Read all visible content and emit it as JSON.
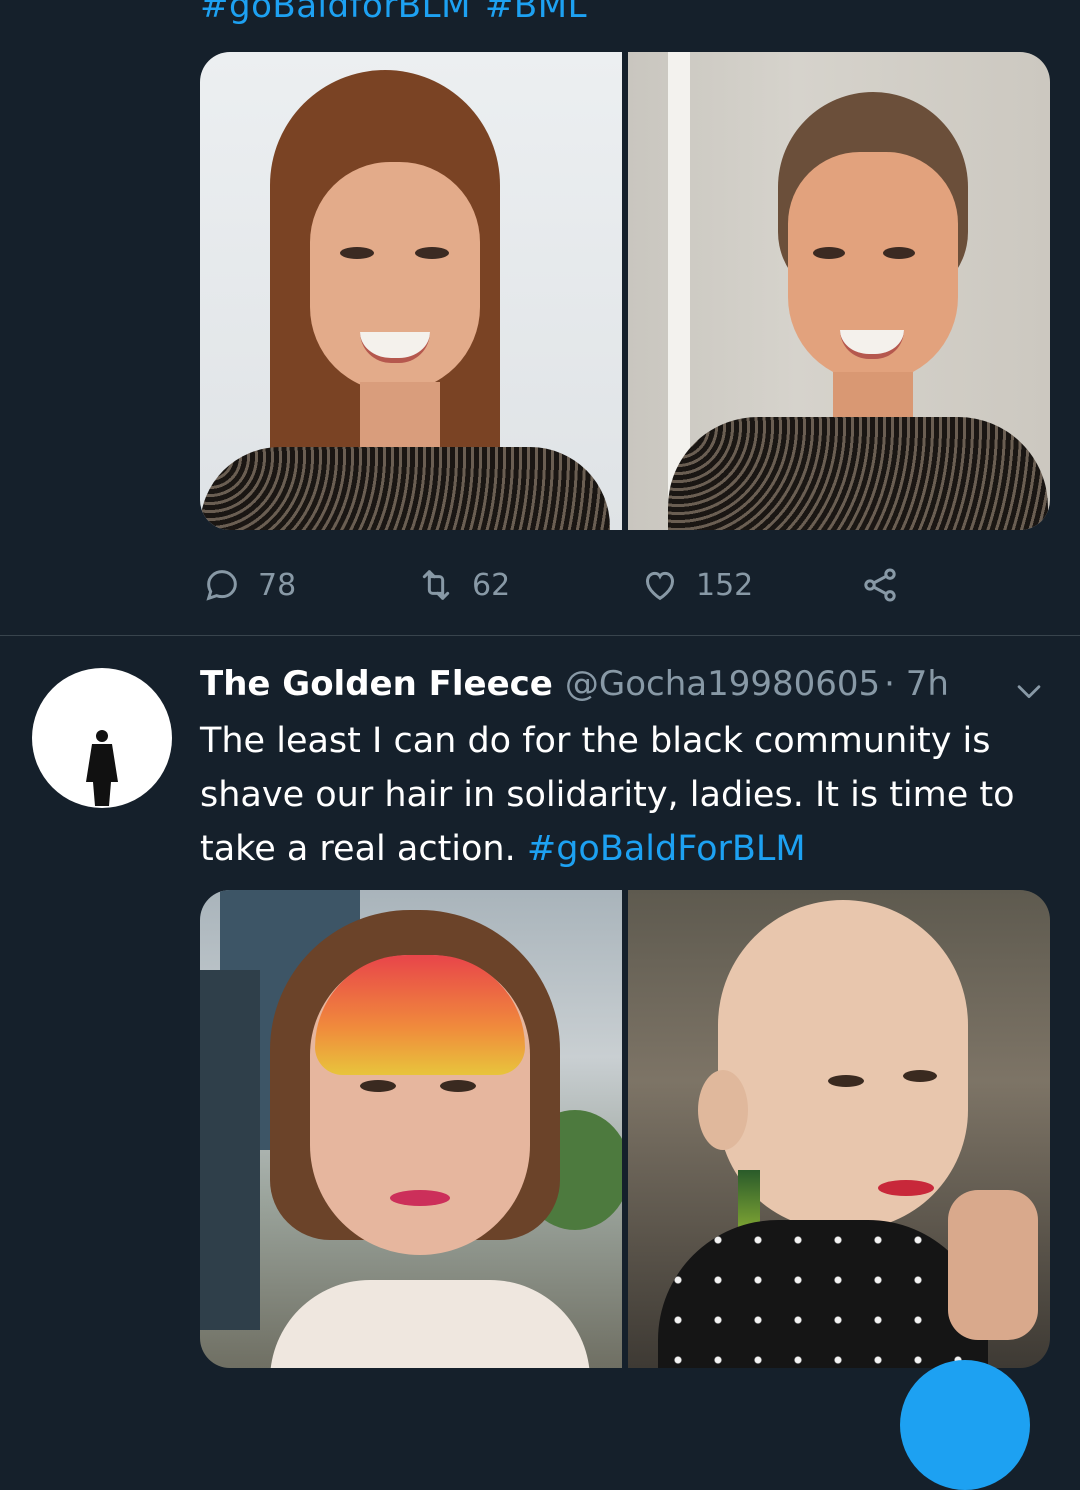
{
  "colors": {
    "background": "#15202b",
    "accent": "#1da1f2",
    "muted": "#8899a6",
    "divider": "#38444d"
  },
  "prev_tweet": {
    "hashtags": [
      "#goBaldforBLM",
      "#BML"
    ],
    "images": [
      "woman-long-hair-photo",
      "woman-shaved-head-photo"
    ],
    "actions": {
      "replies": "78",
      "retweets": "62",
      "likes": "152"
    }
  },
  "tweet": {
    "display_name": "The Golden Fleece",
    "handle": "@Gocha19980605",
    "time": "· 7h",
    "text": "The least I can do for the black community is shave our hair in solidarity, ladies. It is time to take a real action. ",
    "hashtag": "#goBaldForBLM",
    "images": [
      "woman-face-paint-photo",
      "woman-bald-photo"
    ]
  },
  "icons": [
    "reply-icon",
    "retweet-icon",
    "like-icon",
    "share-icon",
    "chevron-down-icon"
  ]
}
